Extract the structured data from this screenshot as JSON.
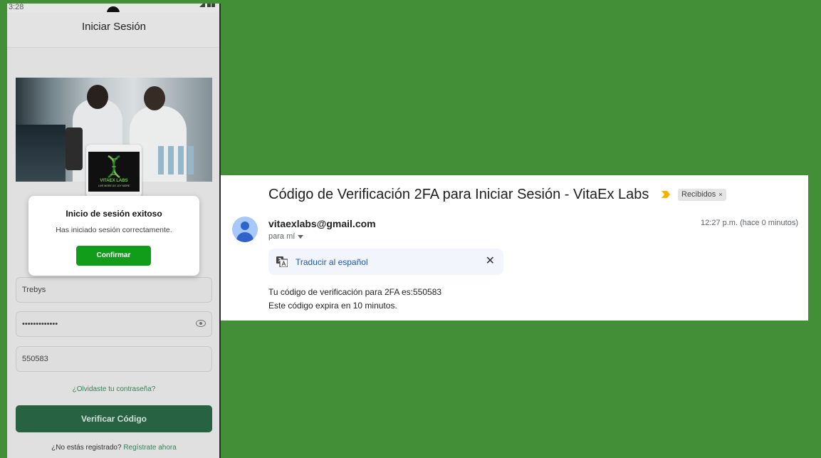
{
  "phone": {
    "status_time": "3:28",
    "header_title": "Iniciar Sesión",
    "logo_brand": "VITAEX LABS",
    "logo_tagline": "LIVE MORE DO JOY MORE",
    "username_value": "Trebys",
    "password_value": "•••••••••••••",
    "code_value": "550583",
    "forgot_link": "¿Olvidaste tu contraseña?",
    "verify_button": "Verificar Código",
    "register_prompt": "¿No estás registrado?",
    "register_link": "Regístrate ahora",
    "dialog": {
      "title": "Inicio de sesión exitoso",
      "message": "Has iniciado sesión correctamente.",
      "confirm_button": "Confirmar"
    }
  },
  "email": {
    "subject": "Código de Verificación 2FA para Iniciar Sesión - VitaEx Labs",
    "label": "Recibidos",
    "label_close": "×",
    "sender": "vitaexlabs@gmail.com",
    "to": "para mí",
    "time": "12:27 p.m. (hace 0 minutos)",
    "translate_link": "Traducir al español",
    "translate_close": "✕",
    "body_line1": "Tu código de verificación para 2FA es:550583",
    "body_line2": "Este código expira en 10 minutos."
  },
  "colors": {
    "background": "#428f37",
    "verify_button": "#2a6a47",
    "confirm_button": "#119c1a",
    "link": "#1a56b8",
    "importance_marker": "#f4b400"
  }
}
